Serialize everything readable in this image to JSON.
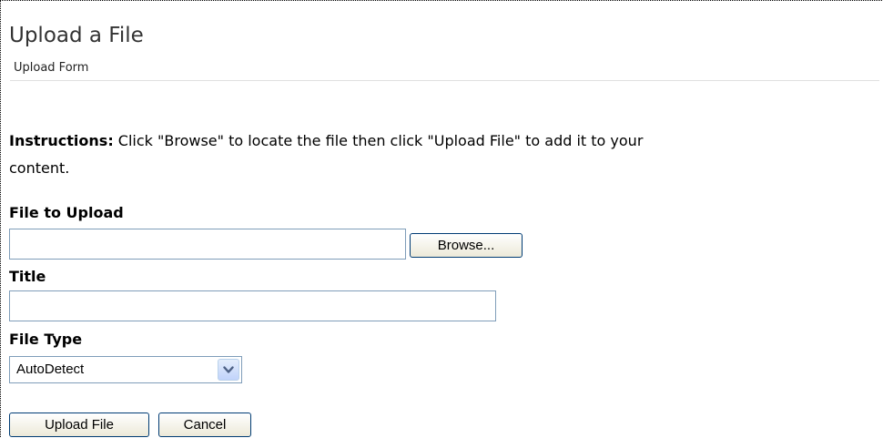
{
  "header": {
    "title": "Upload a File",
    "subtitle": "Upload Form"
  },
  "instructions": {
    "label": "Instructions:",
    "text": " Click \"Browse\" to locate the file then click \"Upload File\" to add it to your",
    "text_line2": "content."
  },
  "form": {
    "file_label": "File to Upload",
    "file_value": "",
    "browse_label": "Browse...",
    "title_label": "Title",
    "title_value": "",
    "type_label": "File Type",
    "type_selected": "AutoDetect",
    "upload_label": "Upload File",
    "cancel_label": "Cancel"
  },
  "icons": {
    "dropdown": "chevron-down-icon"
  },
  "colors": {
    "input_border": "#7f9db9",
    "button_border": "#003c74",
    "dropdown_arrow": "#4d6185"
  }
}
